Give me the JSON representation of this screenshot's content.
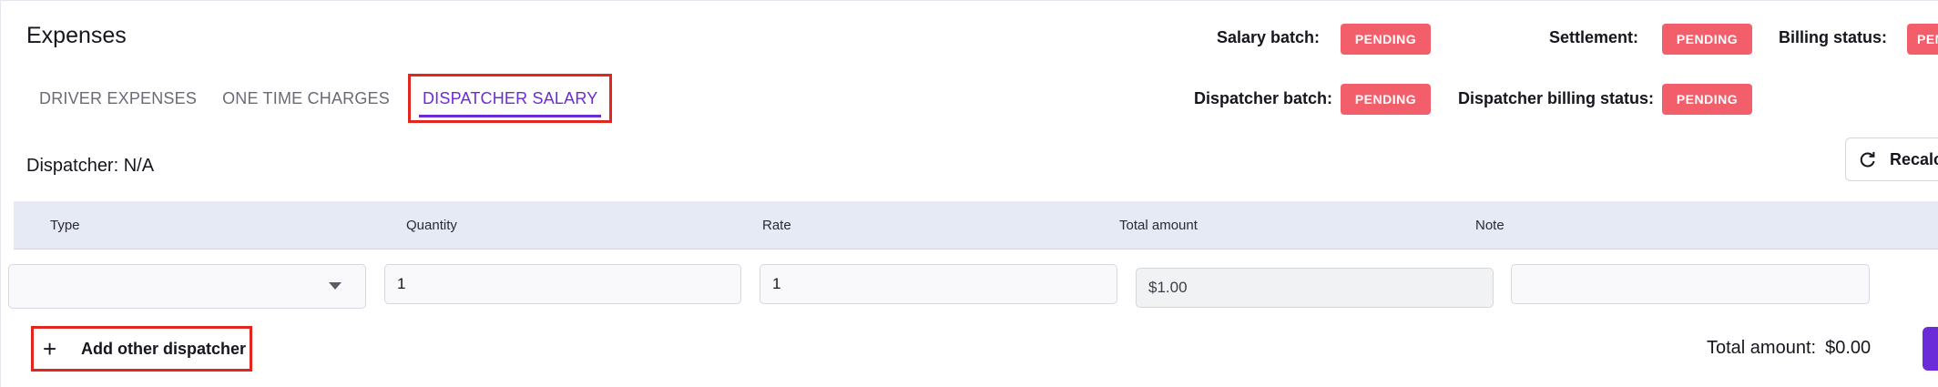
{
  "header": {
    "title": "Expenses"
  },
  "tabs": [
    {
      "label": "DRIVER EXPENSES"
    },
    {
      "label": "ONE TIME CHARGES"
    },
    {
      "label": "DISPATCHER SALARY"
    }
  ],
  "statuses": {
    "salary_batch": {
      "label": "Salary batch:",
      "value": "PENDING"
    },
    "settlement": {
      "label": "Settlement:",
      "value": "PENDING"
    },
    "billing_status": {
      "label": "Billing status:",
      "value": "PEND"
    },
    "dispatcher_batch": {
      "label": "Dispatcher batch:",
      "value": "PENDING"
    },
    "dispatcher_billing_status": {
      "label": "Dispatcher billing status:",
      "value": "PENDING"
    }
  },
  "dispatcher": {
    "label": "Dispatcher: N/A"
  },
  "recalc_button": {
    "label": "Recalc",
    "icon": "refresh-icon"
  },
  "table": {
    "columns": [
      "Type",
      "Quantity",
      "Rate",
      "Total amount",
      "Note"
    ],
    "row": {
      "type": "",
      "quantity": "1",
      "rate": "1",
      "total_amount": "$1.00",
      "note": ""
    }
  },
  "add_dispatcher_button": {
    "label": "Add other dispatcher",
    "icon": "plus-icon"
  },
  "footer": {
    "total_label": "Total amount:",
    "total_value": "$0.00"
  },
  "colors": {
    "accent": "#6c2bd9",
    "badge": "#f25f6b",
    "highlight": "#e0261f",
    "table_header": "#e5eaf4"
  }
}
